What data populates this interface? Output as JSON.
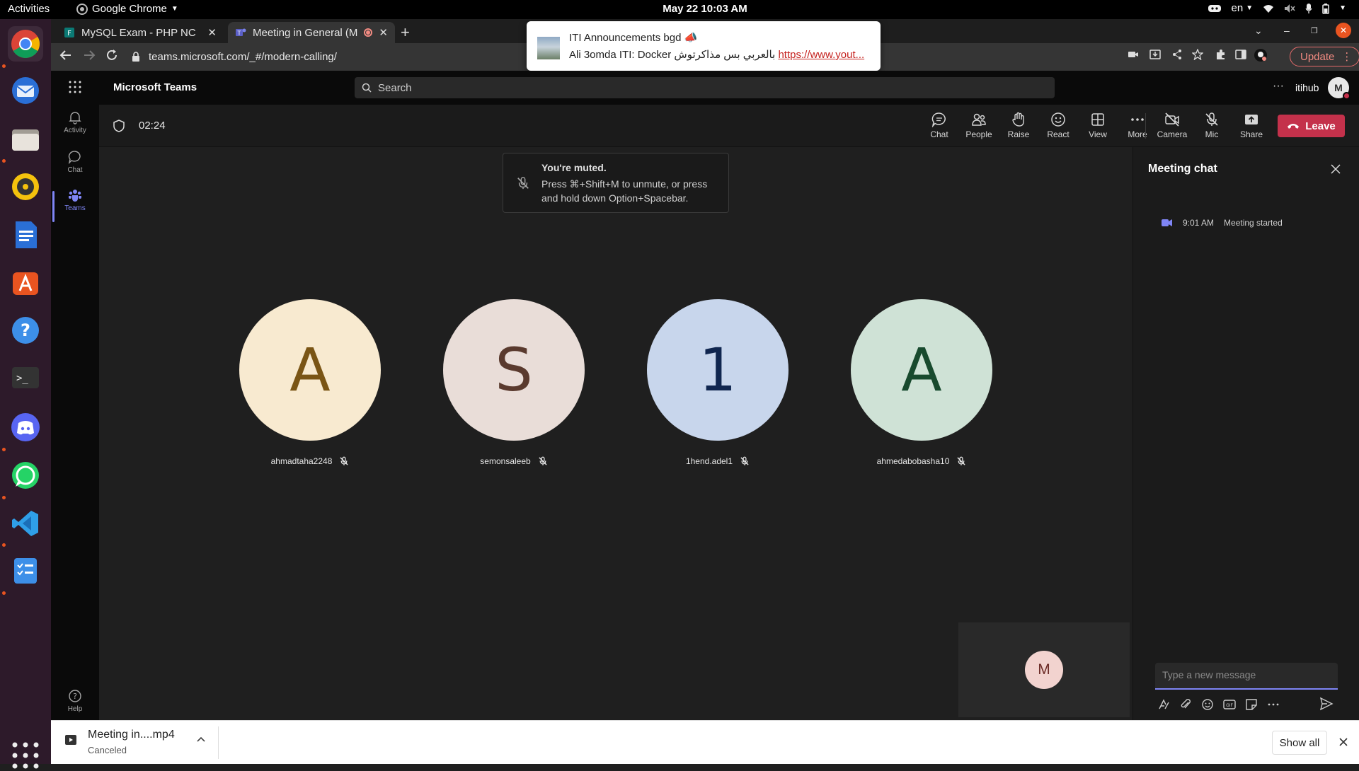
{
  "os": {
    "activities": "Activities",
    "app_menu": "Google Chrome",
    "clock": "May 22  10:03 AM",
    "lang": "en"
  },
  "browser": {
    "tabs": [
      {
        "title": "MySQL Exam - PHP NC",
        "active": false
      },
      {
        "title": "Meeting in General (M",
        "active": true
      }
    ],
    "url": "teams.microsoft.com/_#/modern-calling/",
    "update_label": "Update"
  },
  "notification": {
    "title": "ITI Announcements bgd",
    "body_prefix": "Ali 3omda ITI: Docker بالعربي بس مذاكرتوش",
    "body_link": "https://www.yout..."
  },
  "teams": {
    "brand": "Microsoft Teams",
    "search_placeholder": "Search",
    "org": "itihub",
    "me_initial": "M",
    "rail": [
      {
        "label": "Activity"
      },
      {
        "label": "Chat"
      },
      {
        "label": "Teams"
      },
      {
        "label": "Help"
      }
    ]
  },
  "meeting": {
    "timer": "02:24",
    "controls": {
      "chat": "Chat",
      "people": "People",
      "raise": "Raise",
      "react": "React",
      "view": "View",
      "more": "More",
      "camera": "Camera",
      "mic": "Mic",
      "share": "Share",
      "leave": "Leave"
    },
    "muted_title": "You're muted.",
    "muted_body": "Press ⌘+Shift+M to unmute, or press and hold down Option+Spacebar.",
    "participants": [
      {
        "initial": "A",
        "name": "ahmadtaha2248",
        "bg": "#f8ead0",
        "fg": "#7a5515"
      },
      {
        "initial": "S",
        "name": "semonsaleeb",
        "bg": "#e9ddd8",
        "fg": "#5a3a2e"
      },
      {
        "initial": "1",
        "name": "1hend.adel1",
        "bg": "#c8d6ec",
        "fg": "#10264f"
      },
      {
        "initial": "A",
        "name": "ahmedabobasha10",
        "bg": "#cfe2d6",
        "fg": "#184a2e"
      }
    ],
    "self_initial": "M"
  },
  "chat_panel": {
    "title": "Meeting chat",
    "event_time": "9:01 AM",
    "event_text": "Meeting started",
    "compose_placeholder": "Type a new message"
  },
  "downloads": {
    "file_name": "Meeting in....mp4",
    "status": "Canceled",
    "show_all": "Show all"
  },
  "colors": {
    "accent": "#7f85f5",
    "leave": "#c4314b",
    "dock": "#2d1a2a"
  }
}
